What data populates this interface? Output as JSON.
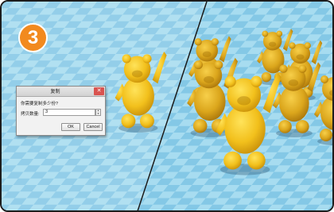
{
  "step": {
    "number": "3",
    "color": "#f28a1e"
  },
  "scene": {
    "floor_color": "#9fd6ec",
    "tile_dark_color": "#7cc2e2",
    "model_color": "#f5c622",
    "model_shadow_color": "#c48c0c",
    "left_panel_models": 1,
    "right_panel_models": 7
  },
  "dialog": {
    "title": "复制",
    "prompt": "你需要复制多少份?",
    "field_label": "拷贝数量:",
    "value": "3",
    "ok_label": "OK",
    "cancel_label": "Cancel",
    "close_icon": "close-icon"
  }
}
